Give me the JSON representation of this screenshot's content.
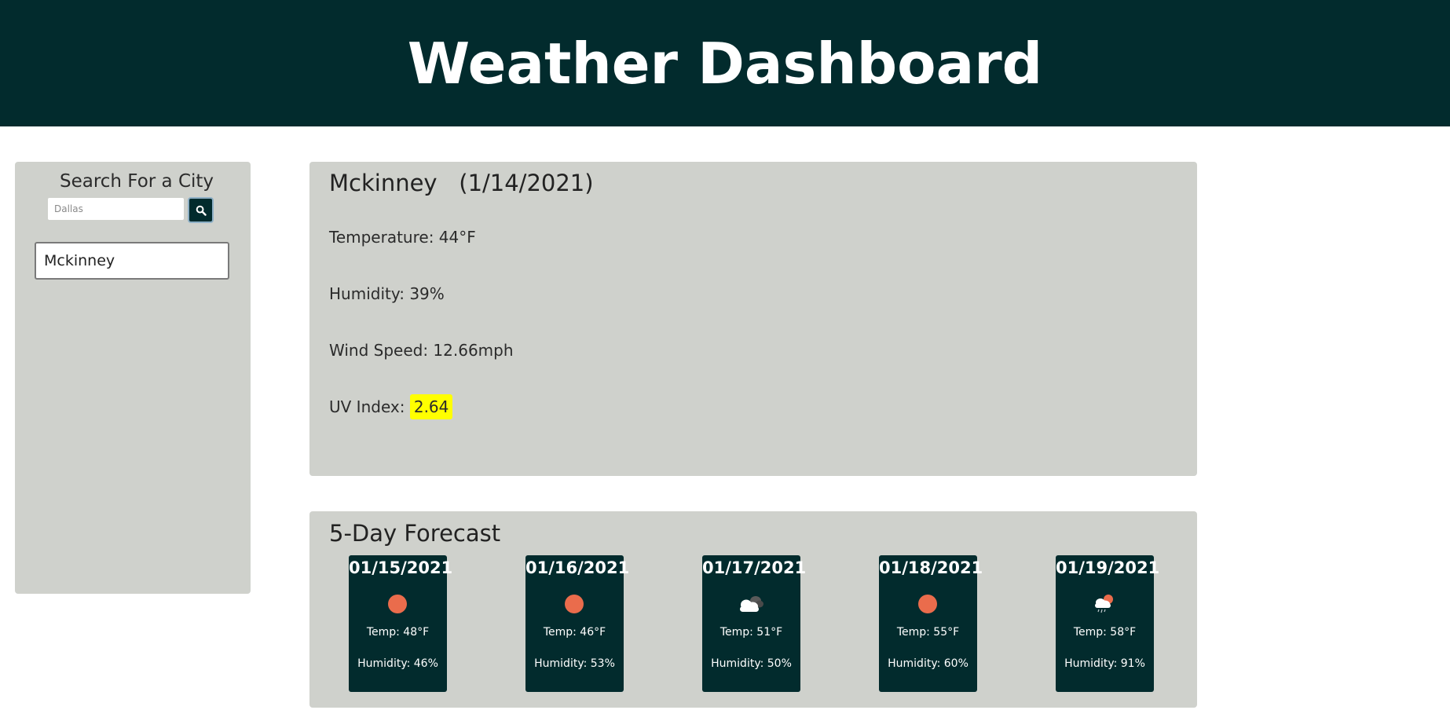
{
  "header": {
    "title": "Weather Dashboard"
  },
  "sidebar": {
    "title": "Search For a City",
    "search": {
      "placeholder": "Dallas",
      "value": ""
    },
    "search_button_icon": "search-icon",
    "history": [
      {
        "label": "Mckinney"
      }
    ]
  },
  "current": {
    "city": "Mckinney",
    "date": "(1/14/2021)",
    "temperature": "Temperature: 44°F",
    "humidity": "Humidity: 39%",
    "wind": "Wind Speed: 12.66mph",
    "uv_label": "UV Index: ",
    "uv_value": "2.64",
    "uv_color": "#ffff00"
  },
  "forecast": {
    "title": "5-Day Forecast",
    "days": [
      {
        "date": "01/15/2021",
        "icon": "clear-sun-icon",
        "temp": "Temp: 48°F",
        "humidity": "Humidity: 46%"
      },
      {
        "date": "01/16/2021",
        "icon": "clear-sun-icon",
        "temp": "Temp: 46°F",
        "humidity": "Humidity: 53%"
      },
      {
        "date": "01/17/2021",
        "icon": "broken-clouds-icon",
        "temp": "Temp: 51°F",
        "humidity": "Humidity: 50%"
      },
      {
        "date": "01/18/2021",
        "icon": "clear-sun-icon",
        "temp": "Temp: 55°F",
        "humidity": "Humidity: 60%"
      },
      {
        "date": "01/19/2021",
        "icon": "rain-sun-icon",
        "temp": "Temp: 58°F",
        "humidity": "Humidity: 91%"
      }
    ]
  },
  "colors": {
    "header_bg": "#022b2d",
    "panel_bg": "#cfd1cc",
    "card_bg": "#022b2d",
    "sun": "#ea6c4c"
  }
}
